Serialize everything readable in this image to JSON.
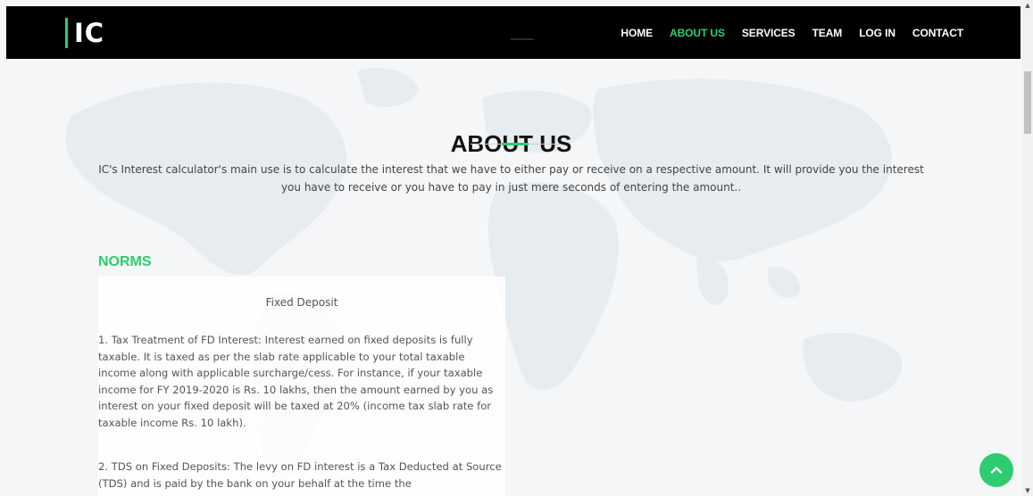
{
  "brand": {
    "logo_text": "IC"
  },
  "nav": {
    "items": [
      "HOME",
      "ABOUT US",
      "SERVICES",
      "TEAM",
      "LOG IN",
      "CONTACT"
    ],
    "active": "ABOUT US"
  },
  "about": {
    "title": "ABOUT US",
    "description": "IC's Interest calculator's main use is to calculate the interest that we have to either pay or receive on a respective amount. It will provide you the interest you have to receive or you have to pay in just mere seconds of entering the amount.."
  },
  "norms": {
    "heading": "NORMS",
    "subheading": "Fixed Deposit",
    "paragraphs": [
      "1. Tax Treatment of FD Interest: Interest earned on fixed deposits is fully taxable. It is taxed as per the slab rate applicable to your total taxable income along with applicable surcharge/cess. For instance, if your taxable income for FY 2019-2020 is Rs. 10 lakhs, then the amount earned by you as interest on your fixed deposit will be taxed at 20% (income tax slab rate for taxable income Rs. 10 lakh).",
      "2. TDS on Fixed Deposits: The levy on FD interest is a Tax Deducted at Source (TDS) and is paid by the bank on your behalf at the time the"
    ]
  },
  "colors": {
    "accent": "#2ecc71",
    "navbar_bg": "#000000",
    "text": "#444444"
  },
  "icons": {
    "scroll_top": "chevron-up-icon"
  }
}
